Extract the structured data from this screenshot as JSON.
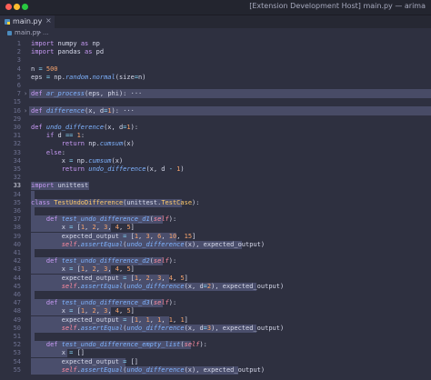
{
  "window": {
    "title": "[Extension Development Host] main.py — arima"
  },
  "tab": {
    "label": "main.py",
    "close": "×"
  },
  "breadcrumb": {
    "file": "main.py",
    "separator": ">",
    "more": "..."
  },
  "colors": {
    "keyword": "#c89af5",
    "function": "#7fb3ff",
    "number": "#f7a46d",
    "operator": "#89ddff",
    "self": "#ff8ba0",
    "class": "#ffcb6b",
    "text": "#d6d9ea",
    "selection": "#4a4e6c"
  },
  "current_line": 33,
  "lines": [
    {
      "n": "1",
      "tokens": [
        [
          "kw",
          "import"
        ],
        [
          "t",
          " numpy "
        ],
        [
          "kw",
          "as"
        ],
        [
          "t",
          " np"
        ]
      ]
    },
    {
      "n": "2",
      "tokens": [
        [
          "kw",
          "import"
        ],
        [
          "t",
          " pandas "
        ],
        [
          "kw",
          "as"
        ],
        [
          "t",
          " pd"
        ]
      ]
    },
    {
      "n": "3",
      "tokens": []
    },
    {
      "n": "4",
      "tokens": [
        [
          "t",
          "n "
        ],
        [
          "op",
          "="
        ],
        [
          "num",
          " 500"
        ]
      ]
    },
    {
      "n": "5",
      "tokens": [
        [
          "t",
          "eps "
        ],
        [
          "op",
          "="
        ],
        [
          "t",
          " np."
        ],
        [
          "fn",
          "random"
        ],
        [
          "t",
          "."
        ],
        [
          "fn",
          "normal"
        ],
        [
          "t",
          "(size"
        ],
        [
          "op",
          "="
        ],
        [
          "t",
          "n)"
        ]
      ]
    },
    {
      "n": "6",
      "tokens": []
    },
    {
      "n": "7",
      "fold": "›",
      "full": true,
      "tokens": [
        [
          "kw",
          "def"
        ],
        [
          "t",
          " "
        ],
        [
          "fn",
          "ar_process"
        ],
        [
          "t",
          "(eps, phi): "
        ],
        [
          "t",
          "···"
        ]
      ]
    },
    {
      "n": "15",
      "tokens": []
    },
    {
      "n": "16",
      "fold": "›",
      "full": true,
      "tokens": [
        [
          "kw",
          "def"
        ],
        [
          "t",
          " "
        ],
        [
          "fn",
          "difference"
        ],
        [
          "t",
          "(x, d"
        ],
        [
          "op",
          "="
        ],
        [
          "num",
          "1"
        ],
        [
          "t",
          "): "
        ],
        [
          "t",
          "···"
        ]
      ]
    },
    {
      "n": "29",
      "tokens": []
    },
    {
      "n": "30",
      "tokens": [
        [
          "kw",
          "def"
        ],
        [
          "t",
          " "
        ],
        [
          "fn",
          "undo_difference"
        ],
        [
          "t",
          "(x, d"
        ],
        [
          "op",
          "="
        ],
        [
          "num",
          "1"
        ],
        [
          "t",
          "):"
        ]
      ]
    },
    {
      "n": "31",
      "tokens": [
        [
          "t",
          "    "
        ],
        [
          "kw",
          "if"
        ],
        [
          "t",
          " d "
        ],
        [
          "op",
          "=="
        ],
        [
          "num",
          " 1"
        ],
        [
          "t",
          ":"
        ]
      ]
    },
    {
      "n": "32",
      "tokens": [
        [
          "t",
          "        "
        ],
        [
          "kw",
          "return"
        ],
        [
          "t",
          " np."
        ],
        [
          "fn",
          "cumsum"
        ],
        [
          "t",
          "(x)"
        ]
      ]
    },
    {
      "n": "33",
      "tokens": [
        [
          "t",
          "    "
        ],
        [
          "kw",
          "else"
        ],
        [
          "t",
          ":"
        ]
      ]
    },
    {
      "n": "34",
      "tokens": [
        [
          "t",
          "        x "
        ],
        [
          "op",
          "="
        ],
        [
          "t",
          " np."
        ],
        [
          "fn",
          "cumsum"
        ],
        [
          "t",
          "(x)"
        ]
      ]
    },
    {
      "n": "35",
      "tokens": [
        [
          "t",
          "        "
        ],
        [
          "kw",
          "return"
        ],
        [
          "t",
          " "
        ],
        [
          "fn",
          "undo_difference"
        ],
        [
          "t",
          "(x, d "
        ],
        [
          "op",
          "-"
        ],
        [
          "num",
          " 1"
        ],
        [
          "t",
          ")"
        ]
      ]
    },
    {
      "n": "32",
      "tokens": []
    },
    {
      "n": "33",
      "current": true,
      "tokens": [
        [
          "kw",
          "import"
        ],
        [
          "t",
          " unittest"
        ]
      ],
      "sel": 64
    },
    {
      "n": "34",
      "tokens": [],
      "sel": 4
    },
    {
      "n": "35",
      "tokens": [
        [
          "kw",
          "class"
        ],
        [
          "t",
          " "
        ],
        [
          "cls",
          "TestUndoDifference"
        ],
        [
          "t",
          "(unittest."
        ],
        [
          "cls",
          "TestCase"
        ],
        [
          "t",
          "):"
        ]
      ],
      "sel": 166
    },
    {
      "n": "36",
      "tokens": [],
      "sel": 4
    },
    {
      "n": "37",
      "tokens": [
        [
          "t",
          "    "
        ],
        [
          "kw",
          "def"
        ],
        [
          "t",
          " "
        ],
        [
          "fn",
          "test_undo_difference_d1"
        ],
        [
          "t",
          "("
        ],
        [
          "self",
          "self"
        ],
        [
          "t",
          "):"
        ]
      ],
      "sel": 145
    },
    {
      "n": "38",
      "tokens": [
        [
          "t",
          "        x "
        ],
        [
          "op",
          "="
        ],
        [
          "t",
          " ["
        ],
        [
          "num",
          "1"
        ],
        [
          "t",
          ", "
        ],
        [
          "num",
          "2"
        ],
        [
          "t",
          ", "
        ],
        [
          "num",
          "3"
        ],
        [
          "t",
          ", "
        ],
        [
          "num",
          "4"
        ],
        [
          "t",
          ", "
        ],
        [
          "num",
          "5"
        ],
        [
          "t",
          "]"
        ]
      ],
      "sel": 88
    },
    {
      "n": "39",
      "tokens": [
        [
          "t",
          "        expected_output "
        ],
        [
          "op",
          "="
        ],
        [
          "t",
          " ["
        ],
        [
          "num",
          "1"
        ],
        [
          "t",
          ", "
        ],
        [
          "num",
          "3"
        ],
        [
          "t",
          ", "
        ],
        [
          "num",
          "6"
        ],
        [
          "t",
          ", "
        ],
        [
          "num",
          "10"
        ],
        [
          "t",
          ", "
        ],
        [
          "num",
          "15"
        ],
        [
          "t",
          "]"
        ]
      ],
      "sel": 160
    },
    {
      "n": "40",
      "tokens": [
        [
          "t",
          "        "
        ],
        [
          "self",
          "self"
        ],
        [
          "t",
          "."
        ],
        [
          "fn",
          "assertEqual"
        ],
        [
          "t",
          "("
        ],
        [
          "fn",
          "undo_difference"
        ],
        [
          "t",
          "(x), expected_output)"
        ]
      ],
      "sel": 232
    },
    {
      "n": "41",
      "tokens": [],
      "sel": 4
    },
    {
      "n": "42",
      "tokens": [
        [
          "t",
          "    "
        ],
        [
          "kw",
          "def"
        ],
        [
          "t",
          " "
        ],
        [
          "fn",
          "test_undo_difference_d2"
        ],
        [
          "t",
          "("
        ],
        [
          "self",
          "self"
        ],
        [
          "t",
          "):"
        ]
      ],
      "sel": 145
    },
    {
      "n": "43",
      "tokens": [
        [
          "t",
          "        x "
        ],
        [
          "op",
          "="
        ],
        [
          "t",
          " ["
        ],
        [
          "num",
          "1"
        ],
        [
          "t",
          ", "
        ],
        [
          "num",
          "2"
        ],
        [
          "t",
          ", "
        ],
        [
          "num",
          "3"
        ],
        [
          "t",
          ", "
        ],
        [
          "num",
          "4"
        ],
        [
          "t",
          ", "
        ],
        [
          "num",
          "5"
        ],
        [
          "t",
          "]"
        ]
      ],
      "sel": 88
    },
    {
      "n": "44",
      "tokens": [
        [
          "t",
          "        expected_output "
        ],
        [
          "op",
          "="
        ],
        [
          "t",
          " ["
        ],
        [
          "num",
          "1"
        ],
        [
          "t",
          ", "
        ],
        [
          "num",
          "2"
        ],
        [
          "t",
          ", "
        ],
        [
          "num",
          "3"
        ],
        [
          "t",
          ", "
        ],
        [
          "num",
          "4"
        ],
        [
          "t",
          ", "
        ],
        [
          "num",
          "5"
        ],
        [
          "t",
          "]"
        ]
      ],
      "sel": 152
    },
    {
      "n": "45",
      "tokens": [
        [
          "t",
          "        "
        ],
        [
          "self",
          "self"
        ],
        [
          "t",
          "."
        ],
        [
          "fn",
          "assertEqual"
        ],
        [
          "t",
          "("
        ],
        [
          "fn",
          "undo_difference"
        ],
        [
          "t",
          "(x, d"
        ],
        [
          "op",
          "="
        ],
        [
          "num",
          "2"
        ],
        [
          "t",
          "), expected_output)"
        ]
      ],
      "sel": 248
    },
    {
      "n": "46",
      "tokens": [],
      "sel": 4
    },
    {
      "n": "47",
      "tokens": [
        [
          "t",
          "    "
        ],
        [
          "kw",
          "def"
        ],
        [
          "t",
          " "
        ],
        [
          "fn",
          "test_undo_difference_d3"
        ],
        [
          "t",
          "("
        ],
        [
          "self",
          "self"
        ],
        [
          "t",
          "):"
        ]
      ],
      "sel": 145
    },
    {
      "n": "48",
      "tokens": [
        [
          "t",
          "        x "
        ],
        [
          "op",
          "="
        ],
        [
          "t",
          " ["
        ],
        [
          "num",
          "1"
        ],
        [
          "t",
          ", "
        ],
        [
          "num",
          "2"
        ],
        [
          "t",
          ", "
        ],
        [
          "num",
          "3"
        ],
        [
          "t",
          ", "
        ],
        [
          "num",
          "4"
        ],
        [
          "t",
          ", "
        ],
        [
          "num",
          "5"
        ],
        [
          "t",
          "]"
        ]
      ],
      "sel": 88
    },
    {
      "n": "49",
      "tokens": [
        [
          "t",
          "        expected_output "
        ],
        [
          "op",
          "="
        ],
        [
          "t",
          " ["
        ],
        [
          "num",
          "1"
        ],
        [
          "t",
          ", "
        ],
        [
          "num",
          "1"
        ],
        [
          "t",
          ", "
        ],
        [
          "num",
          "1"
        ],
        [
          "t",
          ", "
        ],
        [
          "num",
          "1"
        ],
        [
          "t",
          ", "
        ],
        [
          "num",
          "1"
        ],
        [
          "t",
          "]"
        ]
      ],
      "sel": 152
    },
    {
      "n": "50",
      "tokens": [
        [
          "t",
          "        "
        ],
        [
          "self",
          "self"
        ],
        [
          "t",
          "."
        ],
        [
          "fn",
          "assertEqual"
        ],
        [
          "t",
          "("
        ],
        [
          "fn",
          "undo_difference"
        ],
        [
          "t",
          "(x, d"
        ],
        [
          "op",
          "="
        ],
        [
          "num",
          "3"
        ],
        [
          "t",
          "), expected_output)"
        ]
      ],
      "sel": 248
    },
    {
      "n": "51",
      "tokens": [],
      "sel": 4
    },
    {
      "n": "52",
      "tokens": [
        [
          "t",
          "    "
        ],
        [
          "kw",
          "def"
        ],
        [
          "t",
          " "
        ],
        [
          "fn",
          "test_undo_difference_empty_list"
        ],
        [
          "t",
          "("
        ],
        [
          "self",
          "self"
        ],
        [
          "t",
          "):"
        ]
      ],
      "sel": 176
    },
    {
      "n": "53",
      "tokens": [
        [
          "t",
          "        x "
        ],
        [
          "op",
          "="
        ],
        [
          "t",
          " []"
        ]
      ],
      "sel": 40
    },
    {
      "n": "54",
      "tokens": [
        [
          "t",
          "        expected_output "
        ],
        [
          "op",
          "="
        ],
        [
          "t",
          " []"
        ]
      ],
      "sel": 104
    },
    {
      "n": "55",
      "tokens": [
        [
          "t",
          "        "
        ],
        [
          "self",
          "self"
        ],
        [
          "t",
          "."
        ],
        [
          "fn",
          "assertEqual"
        ],
        [
          "t",
          "("
        ],
        [
          "fn",
          "undo_difference"
        ],
        [
          "t",
          "(x), expected_output)"
        ]
      ],
      "sel": 228
    }
  ]
}
